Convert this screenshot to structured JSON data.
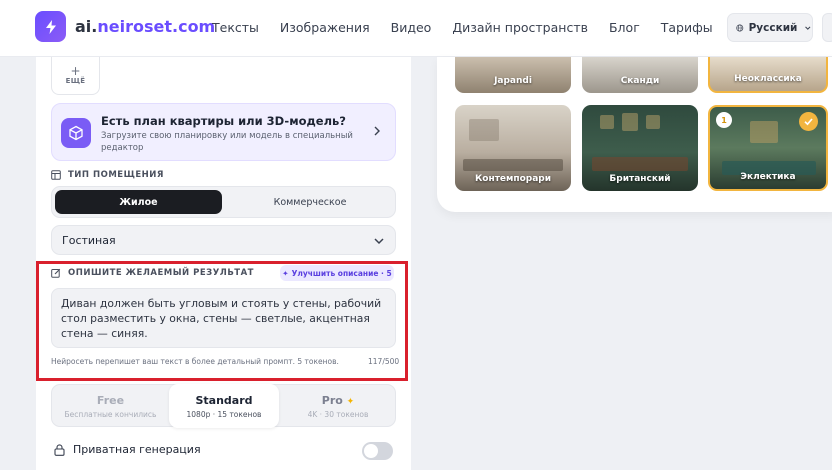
{
  "header": {
    "logo_prefix": "ai.",
    "logo_main": "neiroset",
    "logo_suffix": ".com",
    "nav": [
      "Тексты",
      "Изображения",
      "Видео",
      "Дизайн пространств",
      "Блог",
      "Тарифы"
    ],
    "language": "Русский"
  },
  "more_button": {
    "label": "ЕЩЁ"
  },
  "plan_card": {
    "title": "Есть план квартиры или 3D-модель?",
    "description": "Загрузите свою планировку или модель в специальный редактор"
  },
  "room_type": {
    "label": "ТИП ПОМЕЩЕНИЯ",
    "options": [
      "Жилое",
      "Коммерческое"
    ],
    "selected_room": "Гостиная"
  },
  "desired_result": {
    "label": "ОПИШИТЕ ЖЕЛАЕМЫЙ РЕЗУЛЬТАТ",
    "improve_button": "Улучшить описание · 5",
    "text": "Диван должен быть угловым и стоять у стены, рабочий стол разместить у окна, стены — светлые, акцентная стена — синяя.",
    "hint": "Нейросеть перепишет ваш текст в более детальный промпт. 5 токенов.",
    "counter": "117/500"
  },
  "quality": {
    "tiers": [
      {
        "name": "Free",
        "sub": "Бесплатные кончились"
      },
      {
        "name": "Standard",
        "sub": "1080p · 15 токенов"
      },
      {
        "name": "Pro",
        "sub": "4K · 30 токенов"
      }
    ],
    "selected": "Standard"
  },
  "private_generation": {
    "label": "Приватная генерация",
    "enabled": false
  },
  "styles": {
    "top_row": [
      "Japandi",
      "Сканди",
      "Неоклассика"
    ],
    "bottom_row": [
      "Контемпорари",
      "Британский",
      "Эклектика"
    ],
    "selected_badge": "1"
  },
  "colors": {
    "accent": "#6a4dff",
    "highlight": "#d9202d",
    "selected_border": "#f2b53f"
  }
}
